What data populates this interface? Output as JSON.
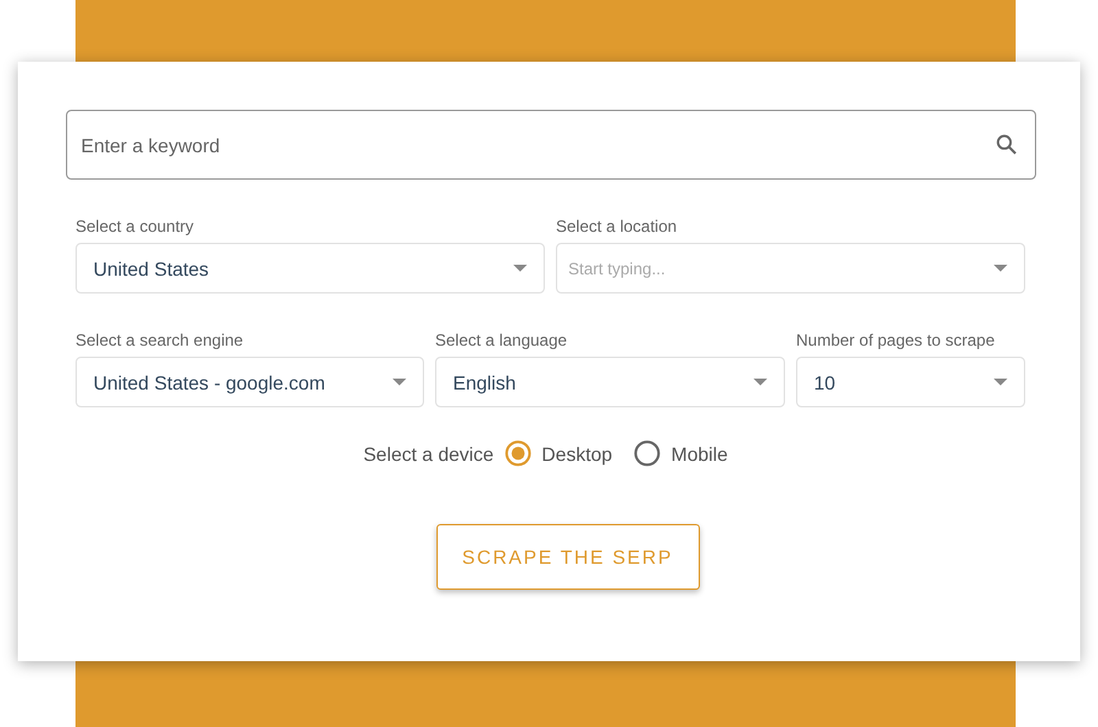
{
  "search": {
    "placeholder": "Enter a keyword"
  },
  "rows": [
    [
      {
        "label": "Select a country",
        "value": "United States"
      },
      {
        "label": "Select a location",
        "placeholder": "Start typing..."
      }
    ],
    [
      {
        "label": "Select a search engine",
        "value": "United States - google.com"
      },
      {
        "label": "Select a language",
        "value": "English"
      },
      {
        "label": "Number of pages to scrape",
        "value": "10"
      }
    ]
  ],
  "device": {
    "label": "Select a device",
    "options": [
      {
        "label": "Desktop",
        "selected": true
      },
      {
        "label": "Mobile",
        "selected": false
      }
    ]
  },
  "button": "SCRAPE THE SERP"
}
